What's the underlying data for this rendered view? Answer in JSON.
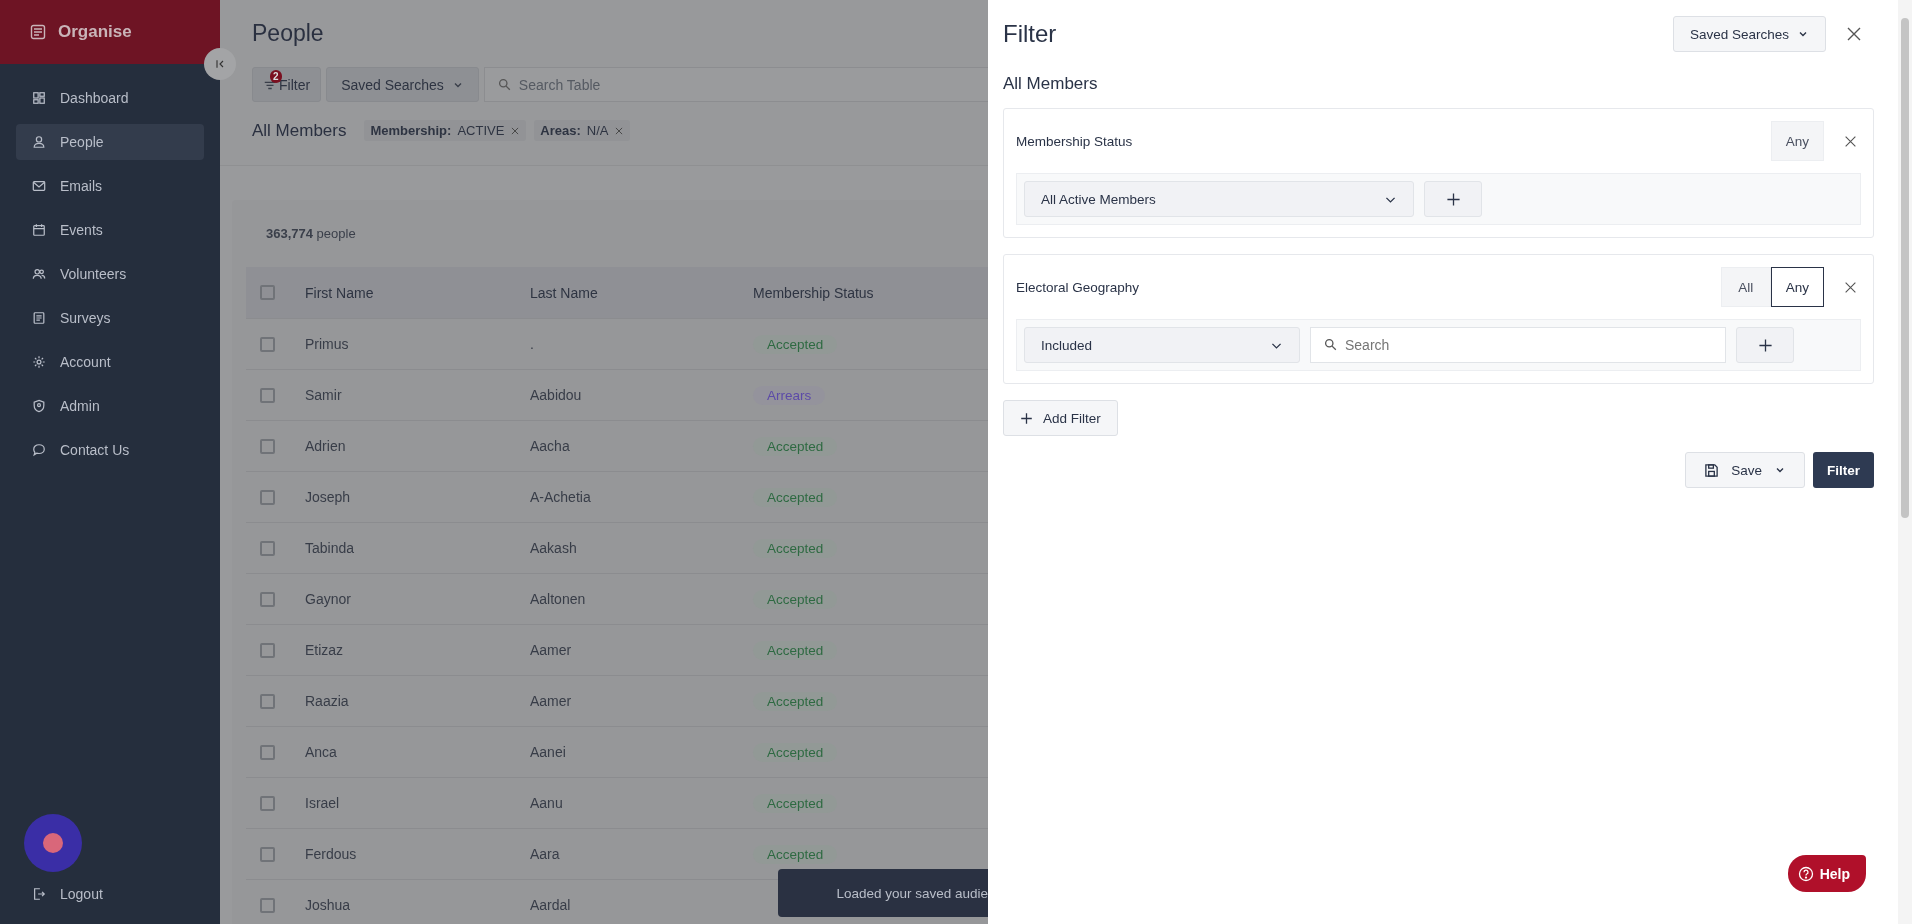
{
  "sidebar": {
    "brand": "Organise",
    "items": [
      {
        "label": "Dashboard",
        "selected": false
      },
      {
        "label": "People",
        "selected": true
      },
      {
        "label": "Emails",
        "selected": false
      },
      {
        "label": "Events",
        "selected": false
      },
      {
        "label": "Volunteers",
        "selected": false
      },
      {
        "label": "Surveys",
        "selected": false
      },
      {
        "label": "Account",
        "selected": false
      },
      {
        "label": "Admin",
        "selected": false
      },
      {
        "label": "Contact Us",
        "selected": false
      }
    ],
    "logout": "Logout"
  },
  "page": {
    "title": "People",
    "filter_button": {
      "label": "Filter",
      "badge": "2"
    },
    "saved_searches": "Saved Searches",
    "search": {
      "placeholder": "Search Table"
    },
    "audience": "All Members",
    "chips": [
      "**Membership:** ACTIVE",
      "**Areas:** N/A"
    ]
  },
  "table": {
    "count": "**363,774** people",
    "all_selected": false,
    "columns": [
      "First Name",
      "Last Name",
      "Membership Status"
    ],
    "rows": [
      {
        "first": "Primus",
        "last": ".",
        "status": {
          "label": "Accepted",
          "kind": "accepted"
        },
        "selected": false
      },
      {
        "first": "Samir",
        "last": "Aabidou",
        "status": {
          "label": "Arrears",
          "kind": "arrears"
        },
        "selected": false
      },
      {
        "first": "Adrien",
        "last": "Aacha",
        "status": {
          "label": "Accepted",
          "kind": "accepted"
        },
        "selected": false
      },
      {
        "first": "Joseph",
        "last": "A-Achetia",
        "status": {
          "label": "Accepted",
          "kind": "accepted"
        },
        "selected": false
      },
      {
        "first": "Tabinda",
        "last": "Aakash",
        "status": {
          "label": "Accepted",
          "kind": "accepted"
        },
        "selected": false
      },
      {
        "first": "Gaynor",
        "last": "Aaltonen",
        "status": {
          "label": "Accepted",
          "kind": "accepted"
        },
        "selected": false
      },
      {
        "first": "Etizaz",
        "last": "Aamer",
        "status": {
          "label": "Accepted",
          "kind": "accepted"
        },
        "selected": false
      },
      {
        "first": "Raazia",
        "last": "Aamer",
        "status": {
          "label": "Accepted",
          "kind": "accepted"
        },
        "selected": false
      },
      {
        "first": "Anca",
        "last": "Aanei",
        "status": {
          "label": "Accepted",
          "kind": "accepted"
        },
        "selected": false
      },
      {
        "first": "Israel",
        "last": "Aanu",
        "status": {
          "label": "Accepted",
          "kind": "accepted"
        },
        "selected": false
      },
      {
        "first": "Ferdous",
        "last": "Aara",
        "status": {
          "label": "Accepted",
          "kind": "accepted"
        },
        "selected": false
      },
      {
        "first": "Joshua",
        "last": "Aardal",
        "selected": false
      }
    ]
  },
  "toast": "Loaded your saved audie",
  "filter_panel": {
    "title": "Filter",
    "saved_searches": "Saved Searches",
    "audience": "All Members",
    "groups": [
      {
        "title": "Membership Status",
        "match": [
          {
            "label": "Any",
            "selected": false
          }
        ],
        "select": "All Active Members"
      },
      {
        "title": "Electoral Geography",
        "match": [
          {
            "label": "All",
            "selected": false
          },
          {
            "label": "Any",
            "selected": true
          }
        ],
        "select": "Included",
        "search": {
          "placeholder": "Search"
        }
      }
    ],
    "add_filter": "Add Filter",
    "save": "Save",
    "apply": "Filter"
  },
  "help": "Help"
}
